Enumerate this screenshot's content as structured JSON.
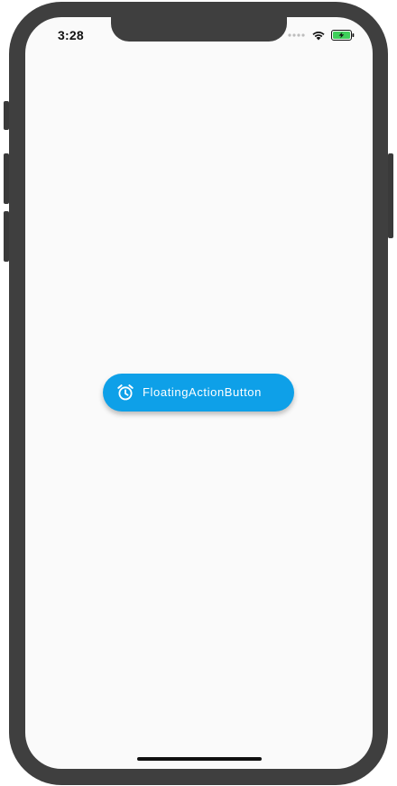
{
  "status_bar": {
    "time": "3:28",
    "signal_icon": "cellular-dots-icon",
    "wifi_icon": "wifi-icon",
    "battery_icon": "battery-charging-icon",
    "battery_color": "#3ecf5a"
  },
  "fab": {
    "label": "FloatingActionButton",
    "icon": "alarm-clock-icon",
    "background_color": "#0ea0e8"
  },
  "device": {
    "frame_color": "#3f3f3f",
    "screen_color": "#fafafa"
  }
}
